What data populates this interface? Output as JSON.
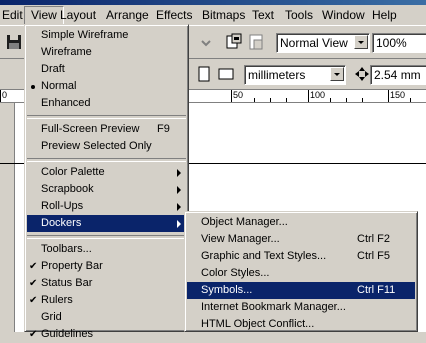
{
  "menubar": {
    "items": [
      "Edit",
      "View",
      "Layout",
      "Arrange",
      "Effects",
      "Bitmaps",
      "Text",
      "Tools",
      "Window",
      "Help"
    ]
  },
  "toolbar": {
    "view_mode": "Normal View",
    "zoom": "100%"
  },
  "propbar": {
    "units": "millimeters",
    "nudge": "2.54 mm"
  },
  "ruler": {
    "labels": [
      "0",
      "50",
      "100",
      "150"
    ]
  },
  "view_menu": {
    "items": [
      {
        "label": "Simple Wireframe"
      },
      {
        "label": "Wireframe"
      },
      {
        "label": "Draft"
      },
      {
        "label": "Normal",
        "mark": "bullet"
      },
      {
        "label": "Enhanced"
      },
      {
        "label": "Full-Screen Preview",
        "shortcut": "F9"
      },
      {
        "label": "Preview Selected Only"
      },
      {
        "label": "Color Palette",
        "submenu": true
      },
      {
        "label": "Scrapbook",
        "submenu": true
      },
      {
        "label": "Roll-Ups",
        "submenu": true
      },
      {
        "label": "Dockers",
        "submenu": true,
        "highlighted": true
      },
      {
        "label": "Toolbars..."
      },
      {
        "label": "Property Bar",
        "mark": "check"
      },
      {
        "label": "Status Bar",
        "mark": "check"
      },
      {
        "label": "Rulers",
        "mark": "check"
      },
      {
        "label": "Grid"
      },
      {
        "label": "Guidelines",
        "mark": "check"
      }
    ]
  },
  "dockers_menu": {
    "items": [
      {
        "label": "Object Manager..."
      },
      {
        "label": "View Manager...",
        "shortcut": "Ctrl F2"
      },
      {
        "label": "Graphic and Text Styles...",
        "shortcut": "Ctrl F5"
      },
      {
        "label": "Color Styles..."
      },
      {
        "label": "Symbols...",
        "shortcut": "Ctrl F11",
        "highlighted": true
      },
      {
        "label": "Internet Bookmark Manager..."
      },
      {
        "label": "HTML Object Conflict..."
      }
    ]
  },
  "colors": {
    "menu_bg": "#d4d0c8",
    "highlight": "#0a246a",
    "highlight_text": "#ffffff"
  }
}
